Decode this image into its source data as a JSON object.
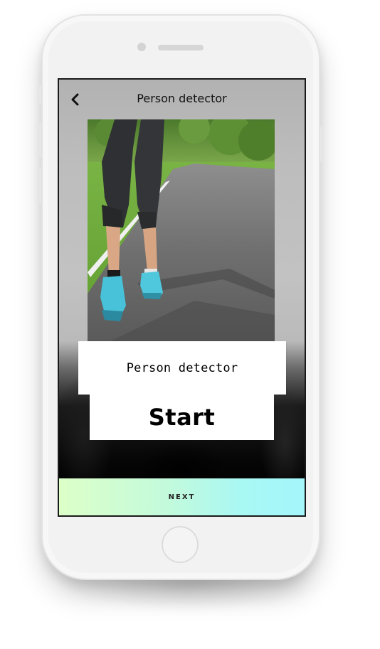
{
  "header": {
    "title": "Person detector",
    "back_icon": "chevron-left-icon"
  },
  "main": {
    "photo_subject": "person-walking-photo",
    "label": "Person detector",
    "start_label": "Start"
  },
  "footer": {
    "next_label": "NEXT"
  },
  "colors": {
    "next_gradient_start": "#ddffc8",
    "next_gradient_end": "#a4f6fb",
    "screen_top": "#b2b2b2",
    "screen_bottom": "#000000"
  }
}
